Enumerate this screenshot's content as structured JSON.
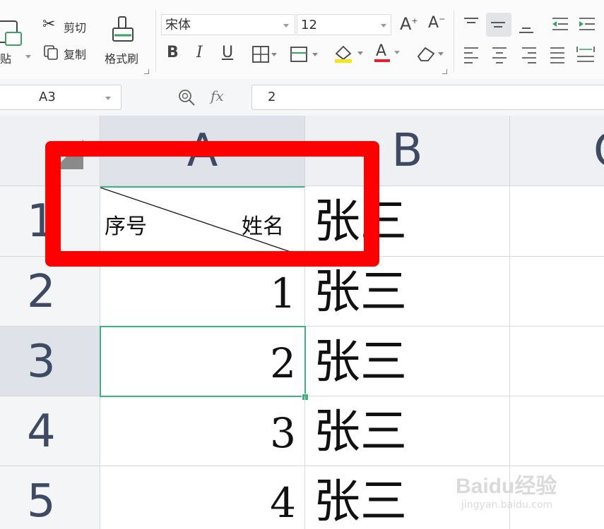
{
  "toolbar": {
    "paste_label": "粘贴",
    "cut_label": "剪切",
    "copy_label": "复制",
    "format_painter_label": "格式刷",
    "font_name": "宋体",
    "font_size": "12",
    "bold": "B",
    "italic": "I",
    "underline": "U",
    "font_color_glyph": "A"
  },
  "formula_bar": {
    "name_box": "A3",
    "fx_label": "fx",
    "content": "2"
  },
  "sheet": {
    "columns": [
      "A",
      "B",
      "C"
    ],
    "rows": [
      "1",
      "2",
      "3",
      "4",
      "5"
    ],
    "a1_left_text": "序号",
    "a1_right_text": "姓名",
    "cells": [
      {
        "a": "",
        "b": "张三"
      },
      {
        "a": "1",
        "b": "张三"
      },
      {
        "a": "2",
        "b": "张三"
      },
      {
        "a": "3",
        "b": "张三"
      },
      {
        "a": "4",
        "b": "张三"
      }
    ],
    "selected_cell": "A3"
  },
  "colors": {
    "selection_green": "#21a366",
    "highlight_red": "#ff0000",
    "header_text": "#3e4a64"
  },
  "watermark": {
    "brand": "Baidu经验",
    "url": "jingyan.baidu.com"
  }
}
